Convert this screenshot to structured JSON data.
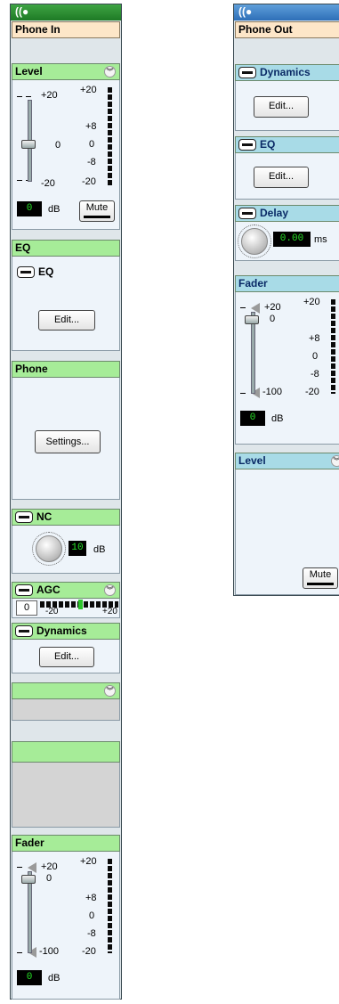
{
  "phone_in": {
    "signal_icon": "signal-icon",
    "name": "Phone In",
    "level": {
      "title": "Level",
      "scale": [
        "+20",
        "0",
        "-20"
      ],
      "meter_labels": [
        "+20",
        "+8",
        "0",
        "-8",
        "-20"
      ],
      "value": "0",
      "unit": "dB",
      "mute_label": "Mute"
    },
    "eq": {
      "title": "EQ",
      "toggle_label": "EQ",
      "edit_label": "Edit..."
    },
    "phone": {
      "title": "Phone",
      "settings_label": "Settings..."
    },
    "nc": {
      "title": "NC",
      "value": "10",
      "unit": "dB"
    },
    "agc": {
      "title": "AGC",
      "value": "0",
      "scale": [
        "-20",
        "+20"
      ]
    },
    "dynamics": {
      "title": "Dynamics",
      "edit_label": "Edit..."
    },
    "fader": {
      "title": "Fader",
      "scale": [
        "+20",
        "0",
        "-100"
      ],
      "meter_labels": [
        "+20",
        "+8",
        "0",
        "-8",
        "-20"
      ],
      "value": "0",
      "unit": "dB"
    }
  },
  "phone_out": {
    "signal_icon": "signal-icon",
    "name": "Phone Out",
    "dynamics": {
      "title": "Dynamics",
      "edit_label": "Edit..."
    },
    "eq": {
      "title": "EQ",
      "edit_label": "Edit..."
    },
    "delay": {
      "title": "Delay",
      "value": "0.00",
      "unit": "ms"
    },
    "fader": {
      "title": "Fader",
      "scale": [
        "+20",
        "0",
        "-100"
      ],
      "meter_labels": [
        "+20",
        "+8",
        "0",
        "-8",
        "-20"
      ],
      "value": "0",
      "unit": "dB"
    },
    "level": {
      "title": "Level",
      "mute_label": "Mute"
    }
  },
  "colors": {
    "green_header": "#a6ec98",
    "blue_header": "#a8dbe7",
    "name_bar": "#fde6c8",
    "display_text": "#27e027"
  }
}
